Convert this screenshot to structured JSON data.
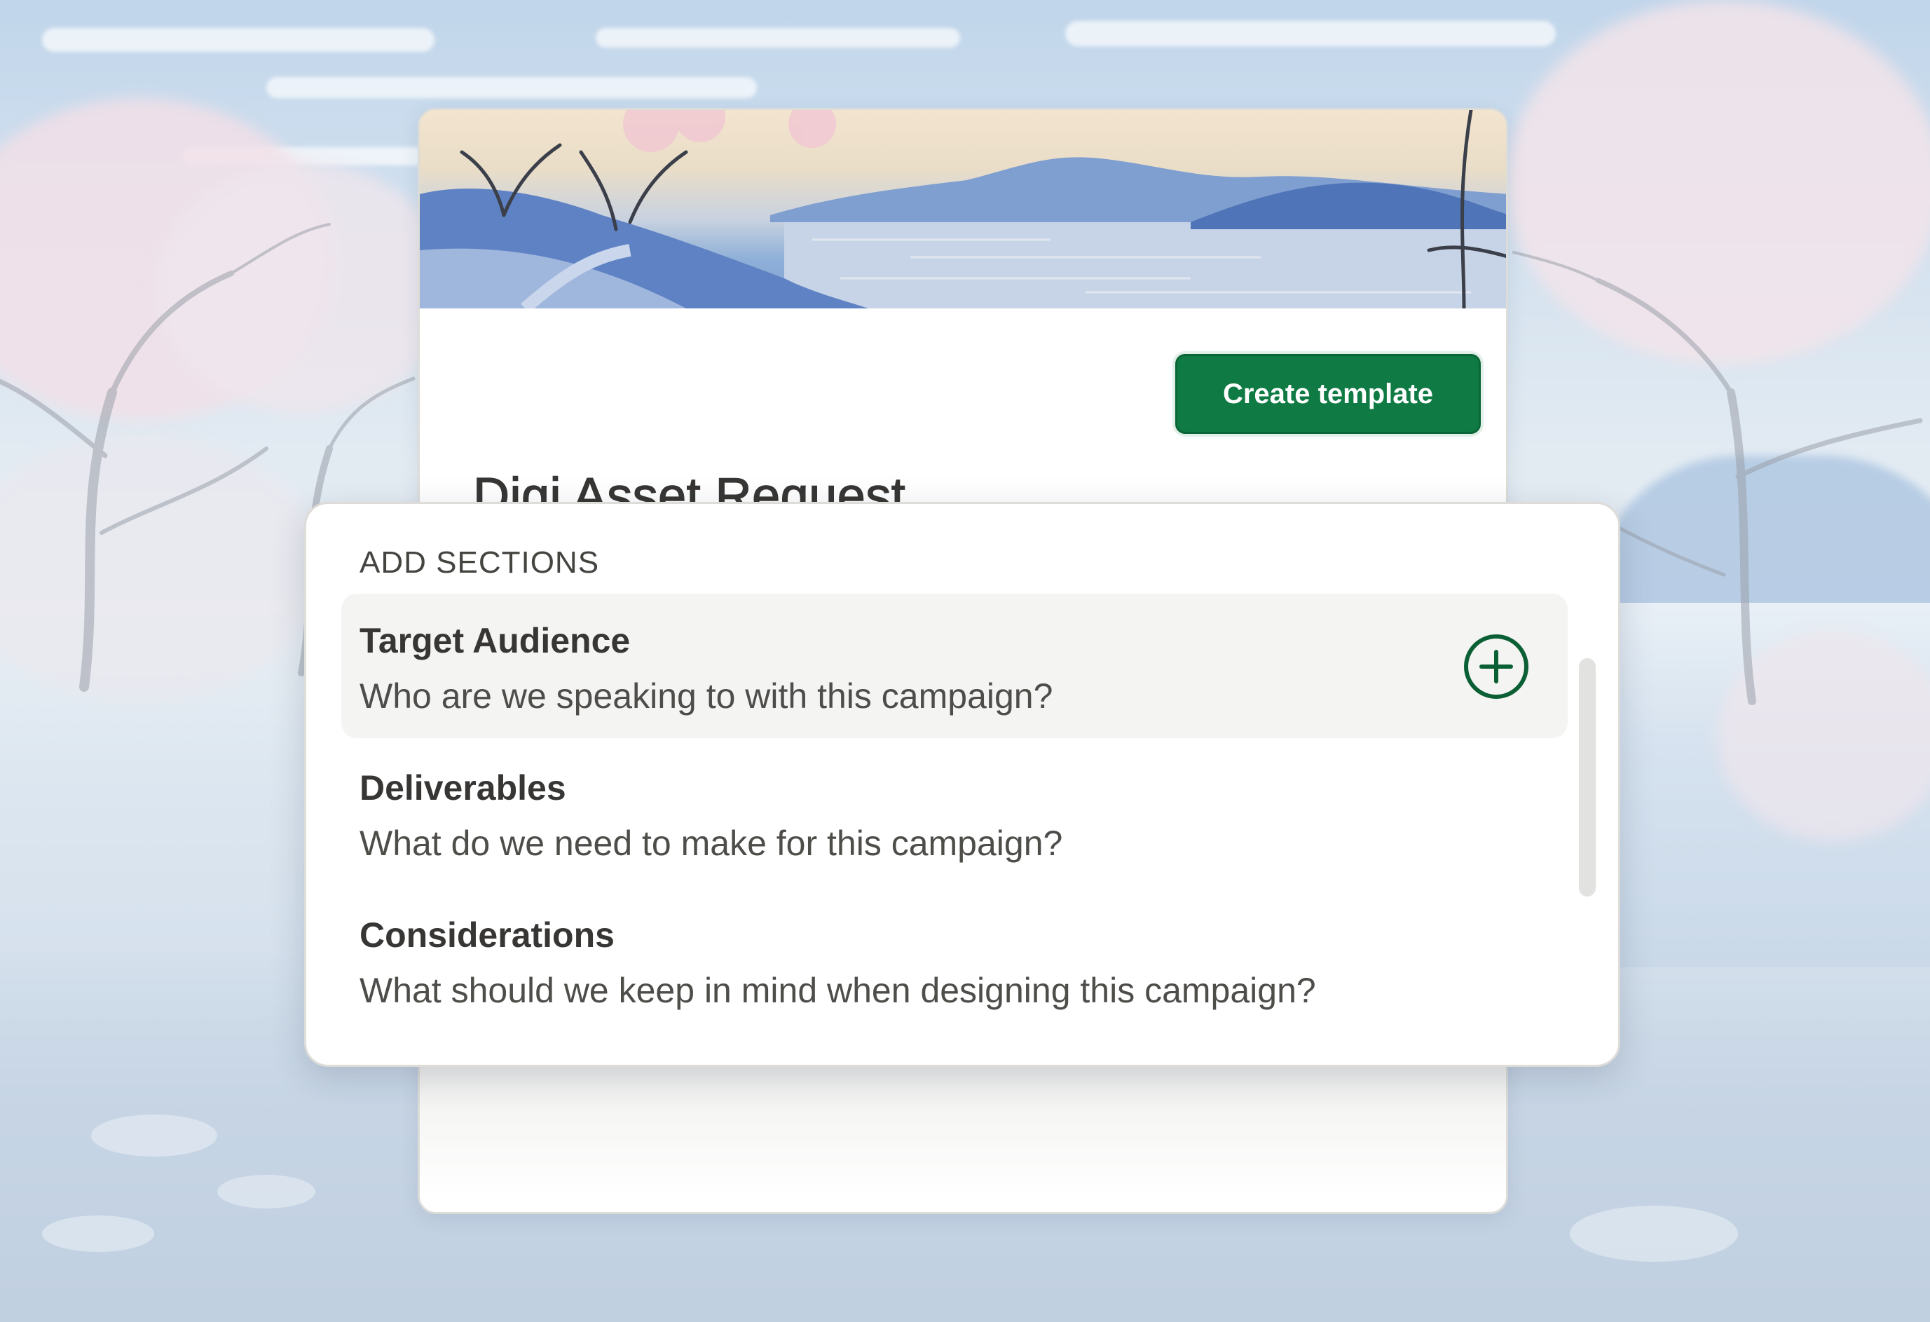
{
  "template": {
    "title": "Digi Asset Request",
    "create_button_label": "Create template"
  },
  "add_sections": {
    "heading": "ADD SECTIONS",
    "items": [
      {
        "name": "Target Audience",
        "description": "Who are we speaking to with this campaign?",
        "hovered": true
      },
      {
        "name": "Deliverables",
        "description": "What do we need to make for this campaign?",
        "hovered": false
      },
      {
        "name": "Considerations",
        "description": "What should we keep in mind when designing this campaign?",
        "hovered": false
      }
    ]
  },
  "icons": {
    "add": "plus-circle-icon"
  },
  "colors": {
    "accent": "#0f7a43",
    "accent_dark": "#0b5f34",
    "text_primary": "#373634",
    "hover_bg": "#f4f4f2"
  }
}
